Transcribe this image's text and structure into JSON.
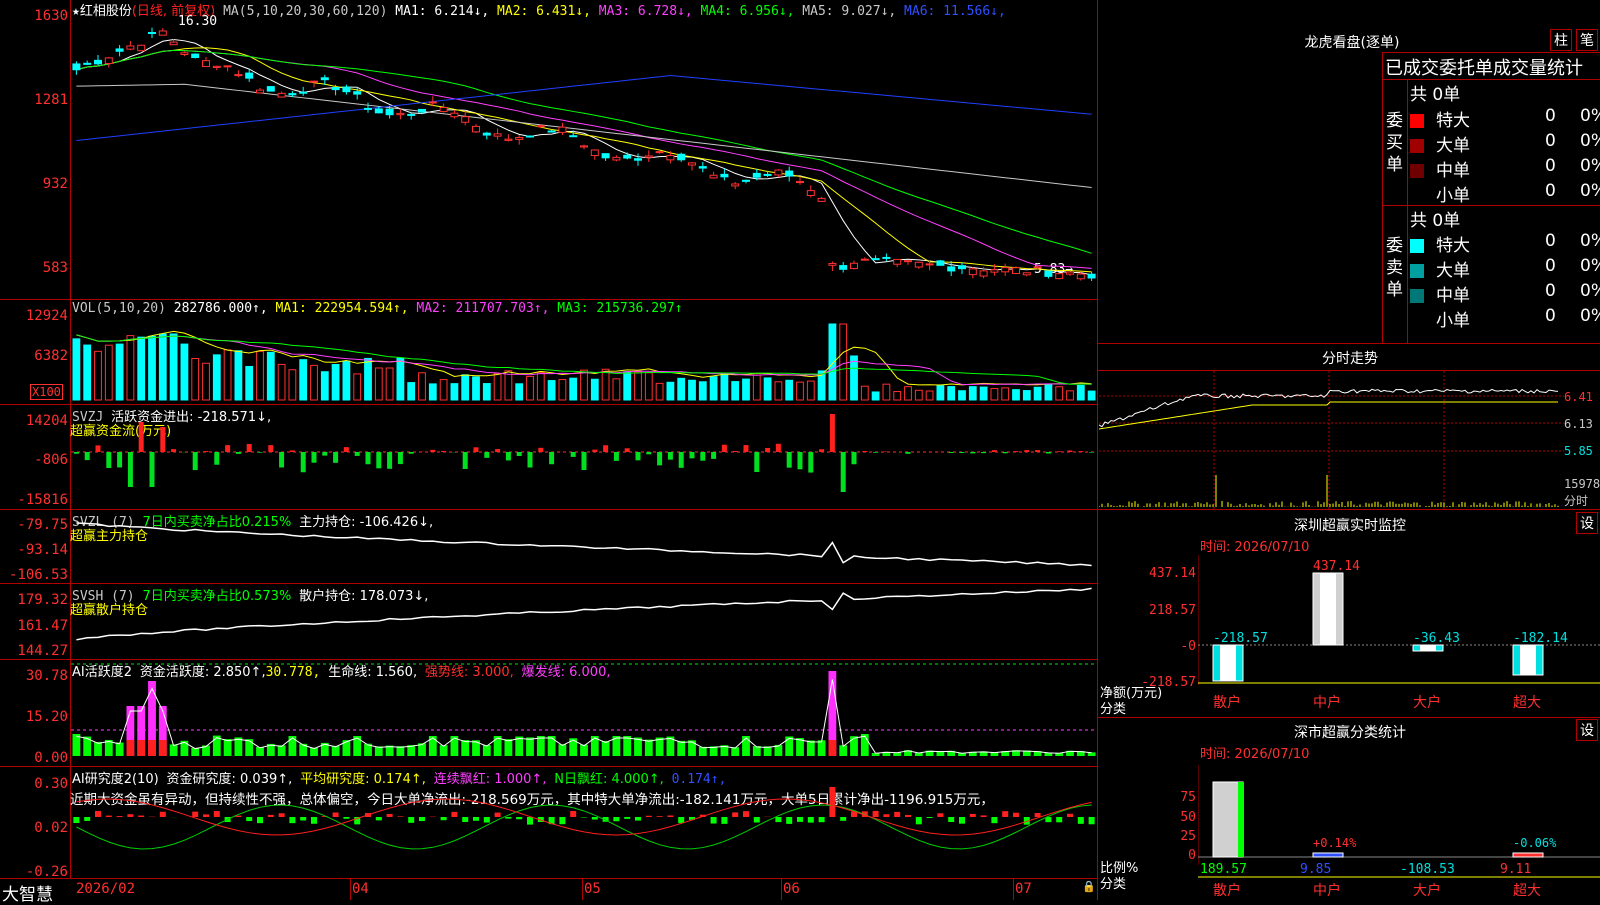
{
  "stock": {
    "name": "红相股份",
    "period": "(日线, 前复权)",
    "ma_header": "MA(5,10,20,30,60,120)",
    "ma1": "MA1: 6.214↓,",
    "ma2": "MA2: 6.431↓,",
    "ma3": "MA3: 6.728↓,",
    "ma4": "MA4: 6.956↓,",
    "ma5": "MA5: 9.027↓,",
    "ma6": "MA6: 11.566↓,",
    "high_label": "16.30",
    "low_label": "5.83→",
    "y_labels": [
      "1630",
      "1281",
      "932",
      "583"
    ]
  },
  "vol": {
    "header": "VOL(5,10,20)",
    "value": "282786.000↑,",
    "ma1": "MA1: 222954.594↑,",
    "ma2": "MA2: 211707.703↑,",
    "ma3": "MA3: 215736.297↑",
    "y_labels": [
      "12924",
      "6382"
    ],
    "unit": "X100"
  },
  "svzj": {
    "header": "SVZJ",
    "label": "活跃资金进出: -218.571↓,",
    "sub": "超赢资金流(万元)",
    "y_labels": [
      "14204",
      "-806",
      "-15816"
    ]
  },
  "svzl": {
    "header": "SVZL (7)",
    "net": "7日内买卖净占比0.215%",
    "hold": "主力持仓: -106.426↓,",
    "sub": "超赢主力持仓",
    "y_labels": [
      "-79.75",
      "-93.14",
      "-106.53"
    ]
  },
  "svsh": {
    "header": "SVSH (7)",
    "net": "7日内买卖净占比0.573%",
    "hold": "散户持仓: 178.073↓,",
    "sub": "超赢散户持仓",
    "y_labels": [
      "179.32",
      "161.47",
      "144.27"
    ]
  },
  "ai_active": {
    "header": "AI活跃度2",
    "a": "资金活跃度: 2.850↑,",
    "b": "30.778,",
    "c": "生命线: 1.560,",
    "d": "强势线: 3.000,",
    "e": "爆发线: 6.000,",
    "y_labels": [
      "30.78",
      "15.20",
      "0.00"
    ]
  },
  "ai_research": {
    "header": "AI研究度2(10)",
    "a": "资金研究度: 0.039↑,",
    "b": "平均研究度: 0.174↑,",
    "c": "连续飘红: 1.000↑,",
    "d": "N日飘红: 4.000↑,",
    "e": "0.174↑,",
    "comment": "近期大资金虽有异动，但持续性不强，总体偏空，今日大单净流出:-218.569万元，其中特大单净流出:-182.141万元，大单5日累计净出-1196.915万元，",
    "y_labels": [
      "0.30",
      "0.02",
      "-0.26"
    ]
  },
  "xaxis": {
    "brand": "大智慧",
    "labels": [
      "2026/02",
      "04",
      "05",
      "06",
      "07"
    ]
  },
  "lhb": {
    "title": "龙虎看盘(逐单)",
    "btn1": "柱",
    "btn2": "笔",
    "subtitle": "已成交委托单成交量统计",
    "buy_side": "委买单",
    "sell_side": "委卖单",
    "buy_total": "共 0单",
    "sell_total": "共 0单",
    "buy_rows": [
      {
        "label": "特大",
        "count": "0",
        "pct": "0%",
        "color": "#ff0000"
      },
      {
        "label": "大单",
        "count": "0",
        "pct": "0%",
        "color": "#a00000"
      },
      {
        "label": "中单",
        "count": "0",
        "pct": "0%",
        "color": "#700000"
      },
      {
        "label": "小单",
        "count": "0",
        "pct": "0%",
        "color": "#000000"
      }
    ],
    "sell_rows": [
      {
        "label": "特大",
        "count": "0",
        "pct": "0%",
        "color": "#00ffff"
      },
      {
        "label": "大单",
        "count": "0",
        "pct": "0%",
        "color": "#00a0a0"
      },
      {
        "label": "中单",
        "count": "0",
        "pct": "0%",
        "color": "#007878"
      },
      {
        "label": "小单",
        "count": "0",
        "pct": "0%",
        "color": "#000000"
      }
    ]
  },
  "intraday": {
    "title": "分时走势",
    "y_labels": [
      "6.41",
      "6.13",
      "5.85"
    ],
    "vol_label": "15978",
    "vol_unit": "分时"
  },
  "monitor": {
    "title": "深圳超赢实时监控",
    "btn": "设",
    "time": "时间: 2026/07/10",
    "y_labels": [
      "437.14",
      "218.57",
      "-0",
      "-218.57"
    ],
    "axis_title": "净额(万元)",
    "cat_title": "分类",
    "categories": [
      "散户",
      "中户",
      "大户",
      "超大"
    ],
    "values": [
      -218.57,
      437.14,
      -36.43,
      -182.14
    ],
    "value_labels": [
      "-218.57",
      "437.14",
      "-36.43",
      "-182.14"
    ]
  },
  "classify": {
    "title": "深市超赢分类统计",
    "btn": "设",
    "time": "时间: 2026/07/10",
    "y_labels": [
      "75",
      "50",
      "25",
      "0"
    ],
    "axis_title": "比例%",
    "cat_title": "分类",
    "categories": [
      "散户",
      "中户",
      "大户",
      "超大"
    ],
    "values": [
      189.57,
      9.85,
      -108.53,
      9.11
    ],
    "value_labels": [
      "189.57",
      "9.85",
      "-108.53",
      "9.11"
    ],
    "pct_labels": [
      "+0.14%",
      "-0.06%"
    ]
  }
}
